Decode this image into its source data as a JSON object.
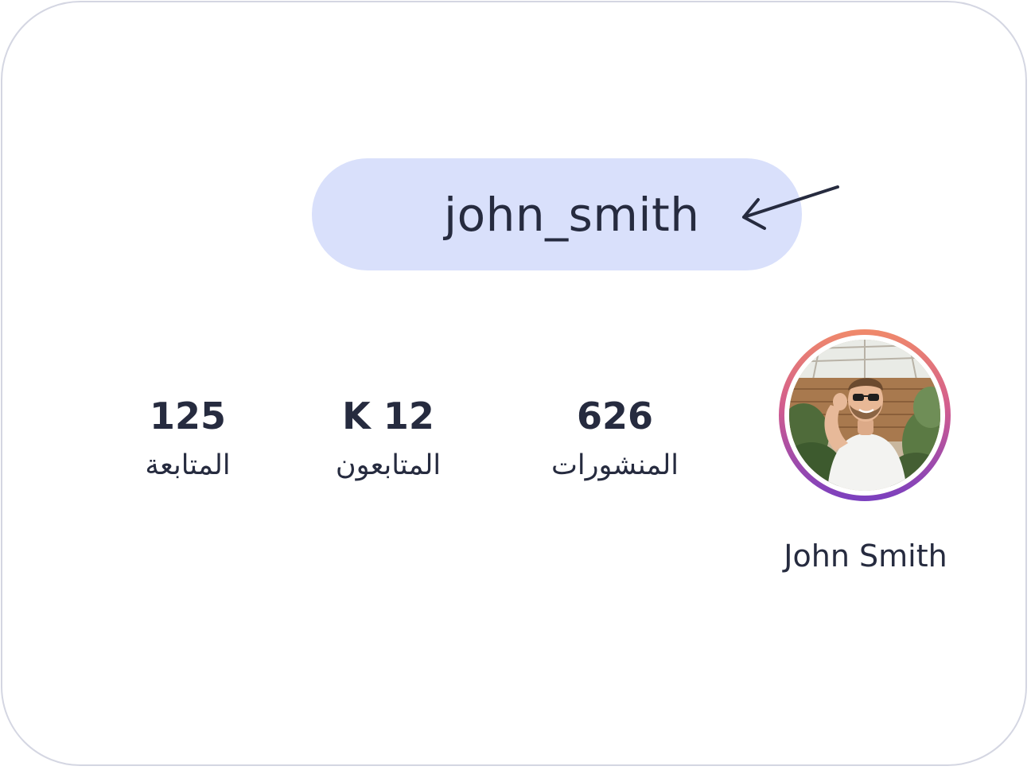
{
  "profile": {
    "username": "john_smith",
    "display_name": "John Smith",
    "stats": [
      {
        "value": "125",
        "label": "المتابعة"
      },
      {
        "value": "K 12",
        "label": "المتابعون"
      },
      {
        "value": "626",
        "label": "المنشورات"
      }
    ]
  },
  "icons": {
    "arrow": "arrow-left-icon",
    "avatar": "avatar-photo"
  },
  "colors": {
    "pill_bg": "#d9e0fb",
    "text": "#262b3f",
    "ring_top": "#f08a6a",
    "ring_bottom": "#7a3fbf",
    "card_border": "#d4d6e2"
  }
}
